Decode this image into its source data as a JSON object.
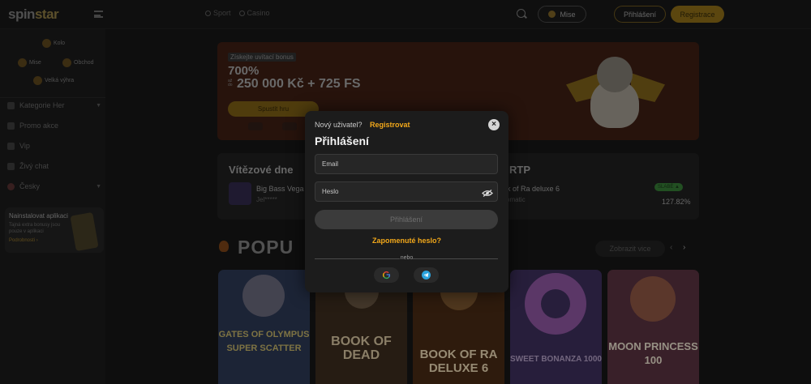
{
  "brand": {
    "logo_text": "spin",
    "logo_text_star": "star",
    "accent": "#f2a81a"
  },
  "header": {
    "nav": [
      {
        "label": "Sport"
      },
      {
        "label": "Casino"
      }
    ],
    "mise_label": "Mise",
    "login_label": "Přihlášení",
    "register_label": "Registrace"
  },
  "sidebar": {
    "quick": [
      {
        "label": "Kolo"
      },
      {
        "label": "Mise"
      },
      {
        "label": "Obchod"
      },
      {
        "label": "Velká výhra"
      }
    ],
    "items": [
      {
        "label": "Kategorie Her"
      },
      {
        "label": "Promo akce"
      },
      {
        "label": "Vip"
      },
      {
        "label": "Živý chat"
      },
      {
        "label": "Česky"
      }
    ],
    "promo": {
      "title": "Nainstalovat aplikaci",
      "desc": "Tajná extra bonusy jsou pouze v aplikaci",
      "link": "Podrobnosti ›"
    }
  },
  "banner": {
    "tag": "Získejte uvítací bonus",
    "percent": "700%",
    "up_to": "až do",
    "amount": "250 000 Kč + 725 FS",
    "cta": "Spustit hru"
  },
  "winners": {
    "title": "Vítězové dne",
    "title2": "RTP",
    "game1": "Big Bass Vega",
    "user1": "Jel*****",
    "game2": "ok of Ra deluxe 6",
    "provider2": "vomatic",
    "badge": "SLABÉ ▲",
    "rtp_value": "127.82%"
  },
  "popular": {
    "title": "POPU",
    "show_all": "Zobrazit vice",
    "games": [
      {
        "title": "GATES OF OLYMPUS SUPER SCATTER",
        "color": "#2a3550"
      },
      {
        "title": "BOOK OF DEAD",
        "color": "#3a2a1c"
      },
      {
        "title": "BOOK OF RA DELUXE 6",
        "color": "#4a2a10"
      },
      {
        "title": "SWEET BONANZA 1000",
        "color": "#3a2a5a"
      },
      {
        "title": "MOON PRINCESS 100",
        "color": "#5a3040"
      }
    ]
  },
  "login_modal": {
    "new_user": "Nový uživatel?",
    "register_link": "Registrovat",
    "title": "Přihlášení",
    "email_placeholder": "Email",
    "password_placeholder": "Heslo",
    "submit": "Přihlášení",
    "forgot": "Zapomenuté heslo?",
    "or": "nebo",
    "social": [
      {
        "icon": "google-icon"
      },
      {
        "icon": "telegram-icon"
      }
    ]
  }
}
